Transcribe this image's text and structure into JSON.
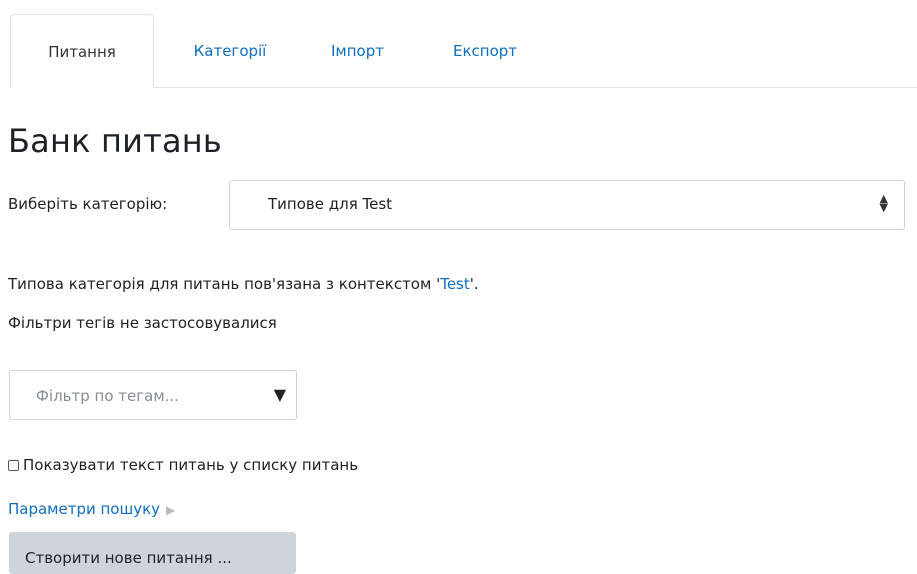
{
  "tabs": [
    {
      "label": "Питання",
      "active": true
    },
    {
      "label": "Категорії",
      "active": false
    },
    {
      "label": "Імпорт",
      "active": false
    },
    {
      "label": "Експорт",
      "active": false
    }
  ],
  "page_title": "Банк питань",
  "category": {
    "label": "Виберіть категорію:",
    "selected": "Типове для Test"
  },
  "info": {
    "text_before": "Типова категорія для питань пов'язана з контекстом '",
    "link": "Test",
    "text_after": "'."
  },
  "tag_status": "Фільтри тегів не застосовувалися",
  "tag_filter": {
    "placeholder": "Фільтр по тегам..."
  },
  "show_question_text": {
    "label": "Показувати текст питань у списку питань",
    "checked": false
  },
  "search_options": {
    "label": "Параметри пошуку",
    "icon": "triangle-right-icon"
  },
  "create_button": {
    "label": "Створити нове питання ..."
  },
  "colors": {
    "link": "#0f6cbf",
    "button_bg": "#ced4da",
    "border": "#dee2e6"
  }
}
